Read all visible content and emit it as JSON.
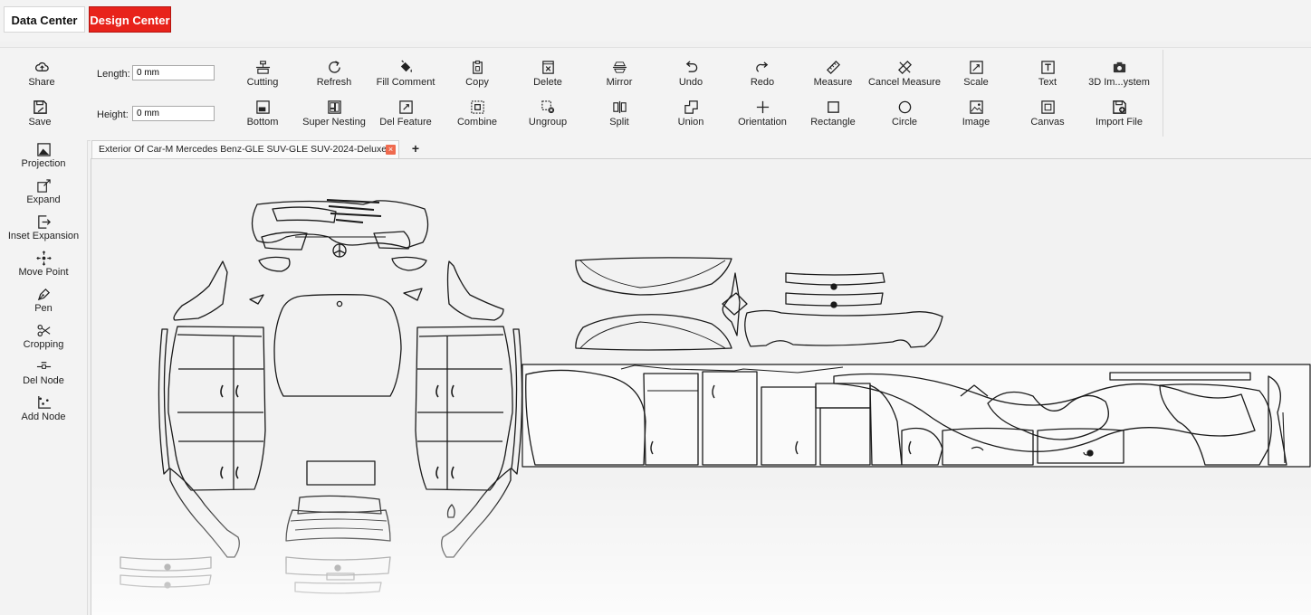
{
  "top": {
    "data_center": "Data Center",
    "design_center": "Design Center"
  },
  "ribbon": {
    "share": "Share",
    "save": "Save",
    "length_label": "Length:",
    "length_value": "0 mm",
    "height_label": "Height:",
    "height_value": "0 mm",
    "row1": [
      "Cutting",
      "Refresh",
      "Fill Comment",
      "Copy",
      "Delete",
      "Mirror",
      "Undo",
      "Redo",
      "Measure",
      "Cancel Measure",
      "Scale",
      "Text",
      "3D Im...ystem"
    ],
    "row2": [
      "Bottom",
      "Super Nesting",
      "Del Feature",
      "Combine",
      "Ungroup",
      "Split",
      "Union",
      "Orientation",
      "Rectangle",
      "Circle",
      "Image",
      "Canvas",
      "Import File"
    ]
  },
  "left_tools": [
    "Projection",
    "Expand",
    "Inset Expansion",
    "Move Point",
    "Pen",
    "Cropping",
    "Del Node",
    "Add Node"
  ],
  "tab": {
    "title": "Exterior Of Car-M Mercedes Benz-GLE SUV-GLE SUV-2024-Deluxe",
    "close": "×",
    "add": "+"
  }
}
